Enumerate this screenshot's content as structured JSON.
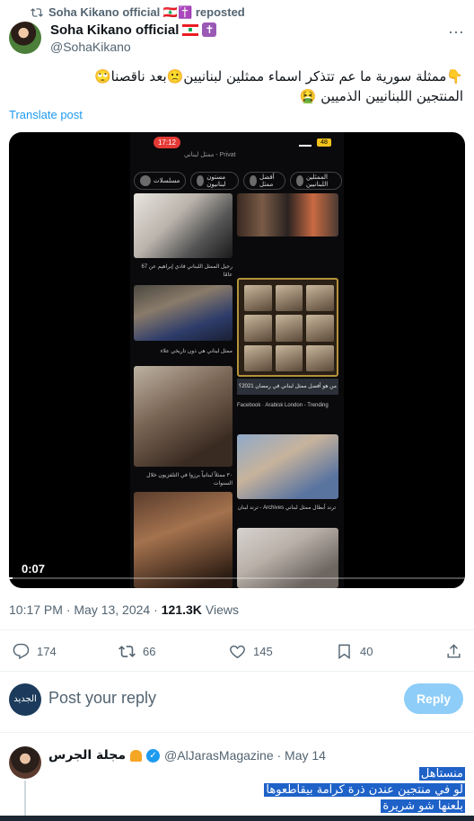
{
  "repost": {
    "text": "Soha Kikano official 🇱🇧✝️ reposted"
  },
  "author": {
    "name": "Soha Kikano official",
    "handle": "@SohaKikano"
  },
  "post": {
    "line1": "👇ممثلة سورية ما عم تتذكر اسماء ممثلين لبنانيين🙁بعد ناقصنا🙄",
    "line2": "المنتجين اللبنانيين الذميين 🤮",
    "translate": "Translate post"
  },
  "video": {
    "timecode": "0:07",
    "status_time": "17:12",
    "battery": "48",
    "search_text": "ممثل لبناني - Privat",
    "chips": [
      "مسلسلات",
      "مستون لبنانيون",
      "أفضل ممثل",
      "الممثلين اللبنانيين"
    ],
    "banner": "من هو أفضل ممثل لبناني في رمضان 2021؟",
    "captions": [
      "رحيل الممثل اللبناني فادي إبراهيم عن 67 عامًا",
      "ممثل لبناني هي ذون تاريخي علاء",
      "٣٠ ممثلاً لبنانياً برزوا في التلفزيون خلال السنوات",
      "Facebook · Arabisk London - Trending",
      "ترند أبطال ممثل لبناني Archives - ترند لبنان"
    ]
  },
  "meta": {
    "time": "10:17 PM · May 13, 2024 ·",
    "views_num": "121.3K",
    "views_label": "Views"
  },
  "actions": {
    "replies": "174",
    "reposts": "66",
    "likes": "145",
    "bookmarks": "40"
  },
  "reply": {
    "avatar_text": "الجديد",
    "placeholder": "Post your reply",
    "button": "Reply"
  },
  "comment": {
    "name": "مجلة الجرس",
    "handle": "@AlJarasMagazine · May 14",
    "lines": [
      "منستاهل",
      "لو في منتجين عندن ذرة كرامة بيقاطعوها",
      "بلعنها شو شريرة"
    ]
  }
}
